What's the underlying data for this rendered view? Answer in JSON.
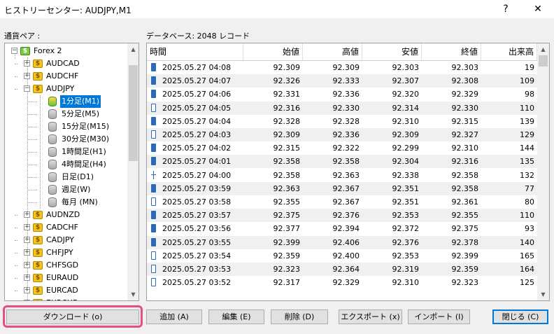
{
  "window": {
    "title": "ヒストリーセンター: AUDJPY,M1",
    "help_glyph": "?",
    "close_glyph": "✕"
  },
  "left_label": "通貨ペア :",
  "db_label": "データベース: 2048 レコード",
  "tree": [
    {
      "label": "Forex 2",
      "level": 0,
      "icon": "green-coin",
      "expander": "−"
    },
    {
      "label": "AUDCAD",
      "level": 1,
      "icon": "coin",
      "expander": "+"
    },
    {
      "label": "AUDCHF",
      "level": 1,
      "icon": "coin",
      "expander": "+"
    },
    {
      "label": "AUDJPY",
      "level": 1,
      "icon": "coin",
      "expander": "−"
    },
    {
      "label": "1分足(M1)",
      "level": 2,
      "icon": "green-db",
      "selected": true
    },
    {
      "label": "5分足(M5)",
      "level": 2,
      "icon": "db"
    },
    {
      "label": "15分足(M15)",
      "level": 2,
      "icon": "db"
    },
    {
      "label": "30分足(M30)",
      "level": 2,
      "icon": "db"
    },
    {
      "label": "1時間足(H1)",
      "level": 2,
      "icon": "db"
    },
    {
      "label": "4時間足(H4)",
      "level": 2,
      "icon": "db"
    },
    {
      "label": "日足(D1)",
      "level": 2,
      "icon": "db"
    },
    {
      "label": "週足(W)",
      "level": 2,
      "icon": "db"
    },
    {
      "label": "毎月 (MN)",
      "level": 2,
      "icon": "db"
    },
    {
      "label": "AUDNZD",
      "level": 1,
      "icon": "coin",
      "expander": "+"
    },
    {
      "label": "CADCHF",
      "level": 1,
      "icon": "coin",
      "expander": "+"
    },
    {
      "label": "CADJPY",
      "level": 1,
      "icon": "coin",
      "expander": "+"
    },
    {
      "label": "CHFJPY",
      "level": 1,
      "icon": "coin",
      "expander": "+"
    },
    {
      "label": "CHFSGD",
      "level": 1,
      "icon": "coin",
      "expander": "+"
    },
    {
      "label": "EURAUD",
      "level": 1,
      "icon": "coin",
      "expander": "+"
    },
    {
      "label": "EURCAD",
      "level": 1,
      "icon": "coin",
      "expander": "+"
    },
    {
      "label": "EURCHF",
      "level": 1,
      "icon": "coin",
      "expander": "+"
    }
  ],
  "columns": [
    "時間",
    "始値",
    "高値",
    "安値",
    "終値",
    "出来高"
  ],
  "rows": [
    {
      "time": "2025.05.27 04:08",
      "open": "92.309",
      "high": "92.309",
      "low": "92.303",
      "close": "92.303",
      "vol": "19",
      "icon": "bear"
    },
    {
      "time": "2025.05.27 04:07",
      "open": "92.326",
      "high": "92.333",
      "low": "92.307",
      "close": "92.308",
      "vol": "109",
      "icon": "bear"
    },
    {
      "time": "2025.05.27 04:06",
      "open": "92.331",
      "high": "92.336",
      "low": "92.320",
      "close": "92.329",
      "vol": "98",
      "icon": "bear"
    },
    {
      "time": "2025.05.27 04:05",
      "open": "92.316",
      "high": "92.330",
      "low": "92.314",
      "close": "92.330",
      "vol": "110",
      "icon": "bull"
    },
    {
      "time": "2025.05.27 04:04",
      "open": "92.328",
      "high": "92.328",
      "low": "92.310",
      "close": "92.315",
      "vol": "139",
      "icon": "bear"
    },
    {
      "time": "2025.05.27 04:03",
      "open": "92.309",
      "high": "92.336",
      "low": "92.309",
      "close": "92.327",
      "vol": "129",
      "icon": "bull"
    },
    {
      "time": "2025.05.27 04:02",
      "open": "92.315",
      "high": "92.322",
      "low": "92.299",
      "close": "92.310",
      "vol": "144",
      "icon": "bear"
    },
    {
      "time": "2025.05.27 04:01",
      "open": "92.358",
      "high": "92.358",
      "low": "92.304",
      "close": "92.316",
      "vol": "135",
      "icon": "bear"
    },
    {
      "time": "2025.05.27 04:00",
      "open": "92.358",
      "high": "92.363",
      "low": "92.338",
      "close": "92.358",
      "vol": "132",
      "icon": "doji"
    },
    {
      "time": "2025.05.27 03:59",
      "open": "92.363",
      "high": "92.367",
      "low": "92.351",
      "close": "92.358",
      "vol": "77",
      "icon": "bear"
    },
    {
      "time": "2025.05.27 03:58",
      "open": "92.355",
      "high": "92.367",
      "low": "92.351",
      "close": "92.361",
      "vol": "80",
      "icon": "bull"
    },
    {
      "time": "2025.05.27 03:57",
      "open": "92.375",
      "high": "92.376",
      "low": "92.353",
      "close": "92.355",
      "vol": "110",
      "icon": "bear"
    },
    {
      "time": "2025.05.27 03:56",
      "open": "92.377",
      "high": "92.394",
      "low": "92.372",
      "close": "92.375",
      "vol": "93",
      "icon": "bear"
    },
    {
      "time": "2025.05.27 03:55",
      "open": "92.399",
      "high": "92.406",
      "low": "92.376",
      "close": "92.378",
      "vol": "140",
      "icon": "bear"
    },
    {
      "time": "2025.05.27 03:54",
      "open": "92.359",
      "high": "92.400",
      "low": "92.353",
      "close": "92.399",
      "vol": "165",
      "icon": "bull"
    },
    {
      "time": "2025.05.27 03:53",
      "open": "92.323",
      "high": "92.364",
      "low": "92.319",
      "close": "92.359",
      "vol": "164",
      "icon": "bull"
    },
    {
      "time": "2025.05.27 03:52",
      "open": "92.317",
      "high": "92.329",
      "low": "92.310",
      "close": "92.323",
      "vol": "125",
      "icon": "bull"
    }
  ],
  "buttons": {
    "download": "ダウンロード (o)",
    "add": "追加 (A)",
    "edit": "編集 (E)",
    "delete": "削除 (D)",
    "export": "エクスポート (x)",
    "import": "インポート (I)",
    "close": "閉じる (C)"
  },
  "colors": {
    "selection": "#0078d7",
    "highlight": "#e8507c",
    "candle": "#2a6ab8"
  }
}
